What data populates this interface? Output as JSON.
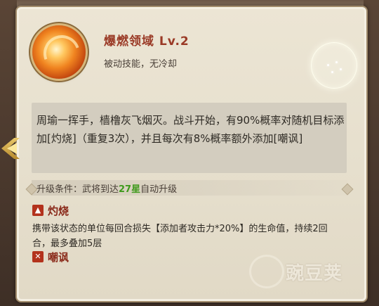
{
  "skill": {
    "name": "爆燃领域 Lv.2",
    "type": "被动技能，无冷却",
    "icon": "fire-swirl-icon",
    "description": "周瑜一挥手，樯橹灰飞烟灭。战斗开始，有90%概率对随机目标添加[灼烧]（重复3次），并且每次有8%概率额外添加[嘲讽]"
  },
  "upgrade": {
    "prefix": "升级条件：武将到达",
    "stars": "27星",
    "suffix": "自动升级"
  },
  "statuses": [
    {
      "name": "灼烧",
      "icon": "flame-icon",
      "description": "携带该状态的单位每回合损失【添加者攻击力*20%】的生命值，持续2回合，最多叠加5层"
    },
    {
      "name": "嘲讽",
      "icon": "taunt-icon"
    }
  ],
  "watermark": {
    "text": "豌豆荚"
  },
  "colors": {
    "title": "#9a3a26",
    "star_highlight": "#3f9a1c",
    "status_name": "#8a2a1a"
  }
}
